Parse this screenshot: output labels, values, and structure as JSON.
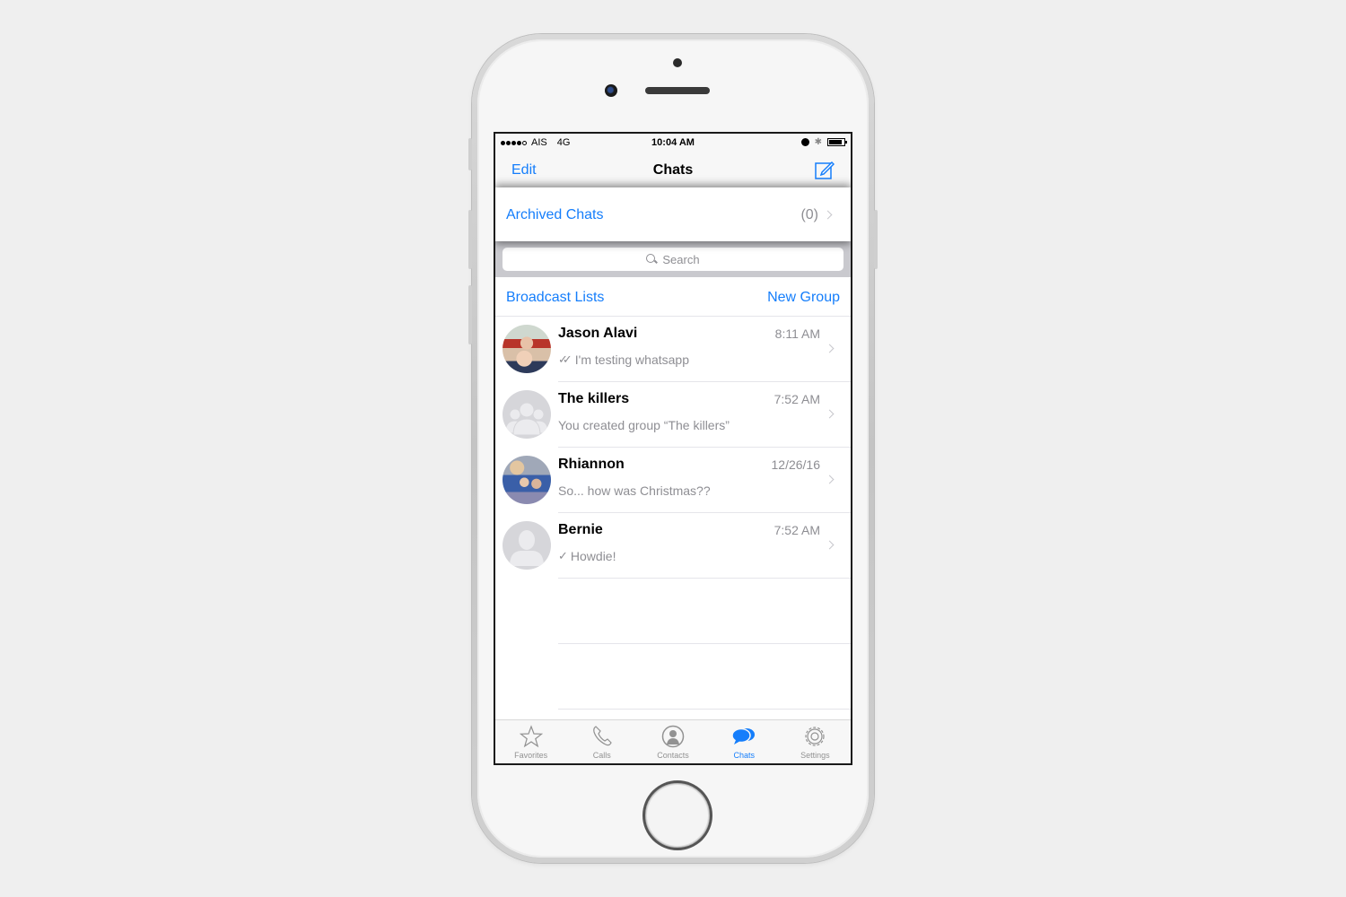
{
  "status_bar": {
    "signal_dots_filled": 4,
    "signal_dots_total": 5,
    "carrier": "AIS",
    "network": "4G",
    "time": "10:04 AM",
    "icons": [
      "alarm-icon",
      "bluetooth-icon",
      "battery-icon"
    ]
  },
  "nav": {
    "edit_label": "Edit",
    "title": "Chats",
    "compose_icon": "compose-icon"
  },
  "archived": {
    "label": "Archived Chats",
    "count": "(0)"
  },
  "search": {
    "placeholder": "Search"
  },
  "actions": {
    "broadcast_label": "Broadcast Lists",
    "new_group_label": "New Group"
  },
  "chats": [
    {
      "name": "Jason Alavi",
      "time": "8:11 AM",
      "preview": "I'm testing whatsapp",
      "status": "double-check",
      "avatar": "photo"
    },
    {
      "name": "The killers",
      "time": "7:52 AM",
      "preview": "You created group “The killers”",
      "status": "none",
      "avatar": "group-placeholder"
    },
    {
      "name": "Rhiannon",
      "time": "12/26/16",
      "preview": "So... how was Christmas??",
      "status": "none",
      "avatar": "photo"
    },
    {
      "name": "Bernie",
      "time": "7:52 AM",
      "preview": "Howdie!",
      "status": "single-check",
      "avatar": "person-placeholder"
    }
  ],
  "tabs": [
    {
      "label": "Favorites",
      "icon": "star-icon",
      "active": false
    },
    {
      "label": "Calls",
      "icon": "phone-icon",
      "active": false
    },
    {
      "label": "Contacts",
      "icon": "contact-icon",
      "active": false
    },
    {
      "label": "Chats",
      "icon": "chat-bubbles-icon",
      "active": true
    },
    {
      "label": "Settings",
      "icon": "gear-icon",
      "active": false
    }
  ],
  "colors": {
    "accent": "#157efb",
    "secondary_text": "#8e8e93",
    "search_bar_bg": "#c9c9ce"
  }
}
